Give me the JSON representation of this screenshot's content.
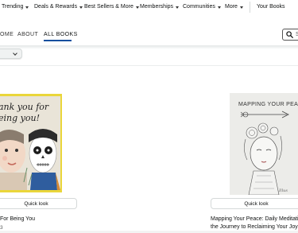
{
  "topnav": {
    "items": [
      {
        "label": "Trending",
        "has_caret": true
      },
      {
        "label": "Deals & Rewards",
        "has_caret": true
      },
      {
        "label": "Best Sellers & More",
        "has_caret": true
      },
      {
        "label": "Memberships",
        "has_caret": true
      },
      {
        "label": "Communities",
        "has_caret": true
      },
      {
        "label": "More",
        "has_caret": true
      }
    ],
    "your_books": "Your Books"
  },
  "store_nav": {
    "home": "OME",
    "about": "ABOUT",
    "all_books": "ALL BOOKS",
    "active": "ALL BOOKS",
    "accent_color": "#0f4f9e"
  },
  "search": {
    "placeholder_visible": "S"
  },
  "products": [
    {
      "title": "For Being You",
      "subtitle": "3",
      "quick_look": "Quick look",
      "cover_text": "ank you for eing you!",
      "cover_border_color": "#ead63a"
    },
    {
      "title": "Mapping Your Peace: Daily Meditati",
      "title_line2": "the Journey to Reclaiming Your Joy",
      "quick_look": "Quick look",
      "cover_text": "MAPPING YOUR PEACE"
    }
  ]
}
